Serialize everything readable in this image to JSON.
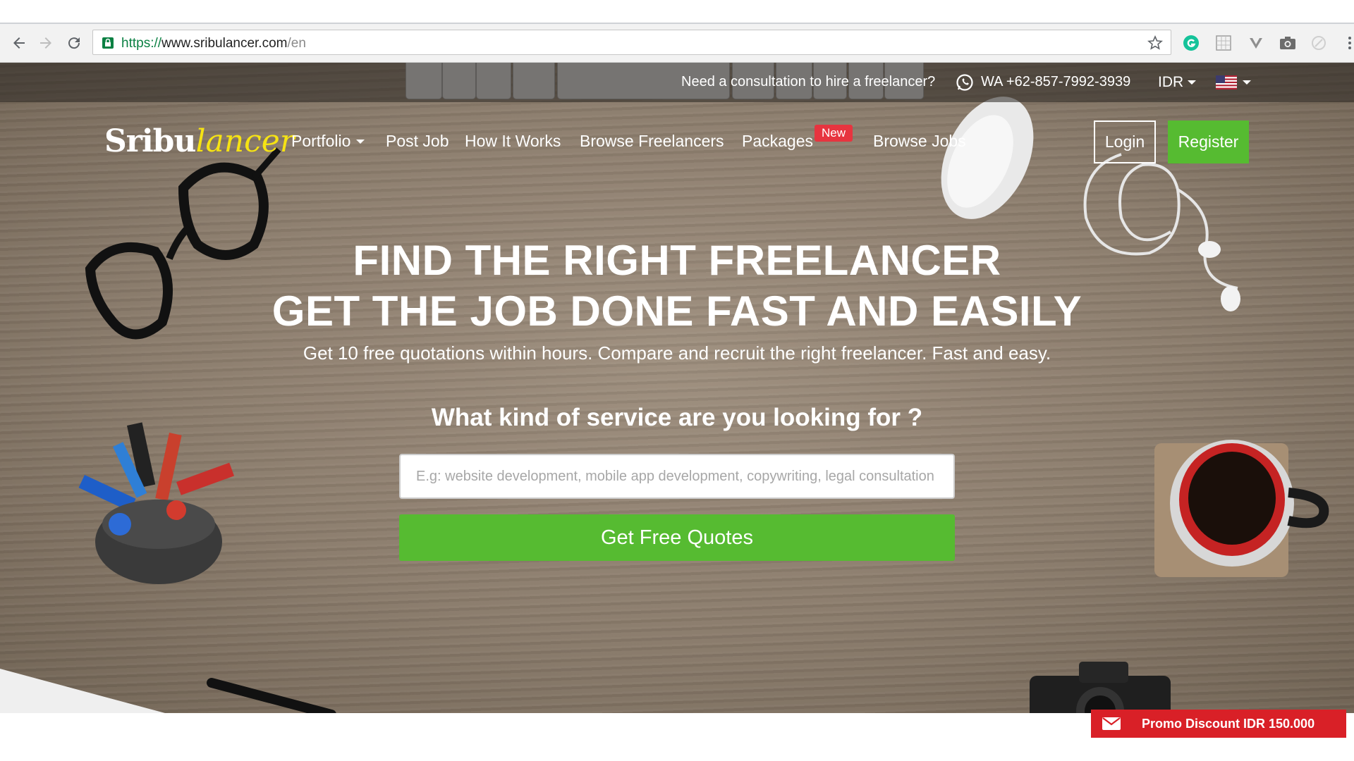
{
  "browser": {
    "url_scheme": "https://",
    "url_host": "www.sribulancer.com",
    "url_path": "/en"
  },
  "topbar": {
    "consult_text": "Need a consultation to hire a freelancer?",
    "wa_number": "WA +62-857-7992-3939",
    "currency": "IDR",
    "language_flag": "us-flag"
  },
  "brand": {
    "logo_part1": "Sribu",
    "logo_part2": "lancer",
    "logo_accent": "#f6e313"
  },
  "nav": {
    "items": [
      {
        "label": "Portfolio",
        "dropdown": true
      },
      {
        "label": "Post Job"
      },
      {
        "label": "How It Works"
      },
      {
        "label": "Browse Freelancers"
      },
      {
        "label": "Packages",
        "badge": "New"
      },
      {
        "label": "Browse Jobs"
      }
    ],
    "login": "Login",
    "register": "Register"
  },
  "hero": {
    "headline_line1": "FIND THE RIGHT FREELANCER",
    "headline_line2": "GET THE JOB DONE FAST AND EASILY",
    "subtitle": "Get 10 free quotations within hours. Compare and recruit the right freelancer. Fast and easy.",
    "question": "What kind of service are you looking for ?",
    "search_placeholder": "E.g: website development, mobile app development, copywriting, legal consultation",
    "cta": "Get Free Quotes"
  },
  "promo": {
    "label": "Promo Discount IDR 150.000"
  },
  "colors": {
    "accent_green": "#56bb31",
    "badge_red": "#e7343f",
    "promo_red": "#d92027"
  }
}
